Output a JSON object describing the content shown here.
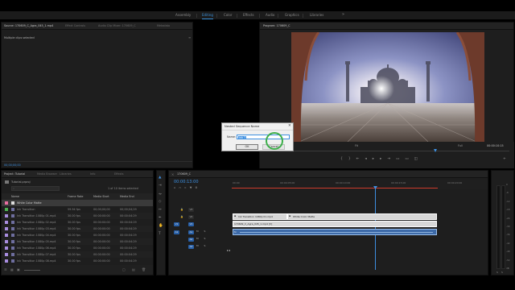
{
  "workspace": {
    "tabs": [
      {
        "label": "Assembly"
      },
      {
        "label": "Editing"
      },
      {
        "label": "Color"
      },
      {
        "label": "Effects"
      },
      {
        "label": "Audio"
      },
      {
        "label": "Graphics"
      },
      {
        "label": "Libraries"
      }
    ],
    "more": "»",
    "active_color": "#3b8fd6"
  },
  "source_panel": {
    "tabs": [
      {
        "label": "Source: 170609_C_Agra_045_1.mp4"
      },
      {
        "label": "Effect Controls"
      },
      {
        "label": "Audio Clip Mixer: 170609_C"
      },
      {
        "label": "Metadata"
      }
    ],
    "message": "Multiple clips selected",
    "timecode": "00;00;00;00"
  },
  "program": {
    "title": "Program: 170609_C",
    "timecode": "00:00:00:00",
    "duration": "00:00:10:15",
    "fit": "Fit",
    "quality": "Full"
  },
  "dialog": {
    "title": "Nested Sequence Name",
    "name_label": "Name:",
    "name_value": "ink 7",
    "ok_label": "OK",
    "cancel_label": "Cancel"
  },
  "project": {
    "tabs": [
      {
        "label": "Project: Tutorial"
      },
      {
        "label": "Media Browser"
      },
      {
        "label": "Libraries"
      },
      {
        "label": "Info"
      },
      {
        "label": "Effects"
      }
    ],
    "project_name": "Tutorial.prproj",
    "search_placeholder": "",
    "count": "1 of 10 items selected",
    "columns": [
      "Name",
      "Frame Rate",
      "Media Start",
      "Media End"
    ],
    "rows": [
      {
        "name": "White Color Matte",
        "rate": "",
        "start": "",
        "end": "",
        "color": "#e86fa1",
        "selected": true
      },
      {
        "name": "Ink Transition",
        "rate": "59.94 fps",
        "start": "00;00;00;00",
        "end": "00;00;04;29",
        "color": "#4caf50",
        "selected": false
      },
      {
        "name": "Ink Transition 1080p 01.mp4",
        "rate": "30.00 fps",
        "start": "00:00:00:00",
        "end": "00:00:04:29",
        "color": "#a98de0",
        "selected": false
      },
      {
        "name": "Ink Transition 1080p 02.mp4",
        "rate": "30.00 fps",
        "start": "00:00:00:00",
        "end": "00:00:04:29",
        "color": "#a98de0",
        "selected": false
      },
      {
        "name": "Ink Transition 1080p 03.mp4",
        "rate": "30.00 fps",
        "start": "00:00:00:00",
        "end": "00:00:04:29",
        "color": "#a98de0",
        "selected": false
      },
      {
        "name": "Ink Transition 1080p 04.mp4",
        "rate": "30.00 fps",
        "start": "00:00:00:00",
        "end": "00:00:04:29",
        "color": "#a98de0",
        "selected": false
      },
      {
        "name": "Ink Transition 1080p 05.mp4",
        "rate": "30.00 fps",
        "start": "00:00:00:00",
        "end": "00:00:04:29",
        "color": "#a98de0",
        "selected": false
      },
      {
        "name": "Ink Transition 1080p 06.mp4",
        "rate": "30.00 fps",
        "start": "00:00:00:00",
        "end": "00:00:04:29",
        "color": "#a98de0",
        "selected": false
      },
      {
        "name": "Ink Transition 1080p 07.mp4",
        "rate": "30.00 fps",
        "start": "00:00:00:00",
        "end": "00:00:04:29",
        "color": "#a98de0",
        "selected": false
      },
      {
        "name": "Ink Transition 1080p 08.mp4",
        "rate": "30.00 fps",
        "start": "00:00:00:00",
        "end": "00:00:04:29",
        "color": "#a98de0",
        "selected": false
      }
    ]
  },
  "timeline": {
    "tab": "170609_C",
    "timecode": "00:00:13:00",
    "ruler": [
      "00:00",
      "00:00:05:00",
      "00:00:10:00",
      "00:00:15:00",
      "00:00:20:00"
    ],
    "video_tracks": [
      "V3",
      "V2",
      "V1"
    ],
    "audio_tracks": [
      "A1",
      "A2",
      "A3"
    ],
    "source_patch": {
      "video": "V1",
      "audio": "A1"
    },
    "clips": [
      {
        "label": "Ink Transition 1080p 01.mp4",
        "track": "V3"
      },
      {
        "label": "White Color Matte",
        "track": "V3"
      },
      {
        "label": "170609_C_Agra_045_1.mp4 [V]",
        "track": "V2"
      }
    ]
  },
  "audio_meter": {
    "labels": [
      "0",
      "-6",
      "-12",
      "-18",
      "-24",
      "-30",
      "-36",
      "-42",
      "-48",
      "-54",
      "dB"
    ],
    "solo": "S",
    "solo_r": "S"
  },
  "colors": {
    "accent": "#3d8fe0",
    "clip_pink": "#d9d9d9",
    "clip_blue": "#3d6aa8",
    "playhead": "#3d8fe0",
    "work_area": "#cc3b2b"
  }
}
